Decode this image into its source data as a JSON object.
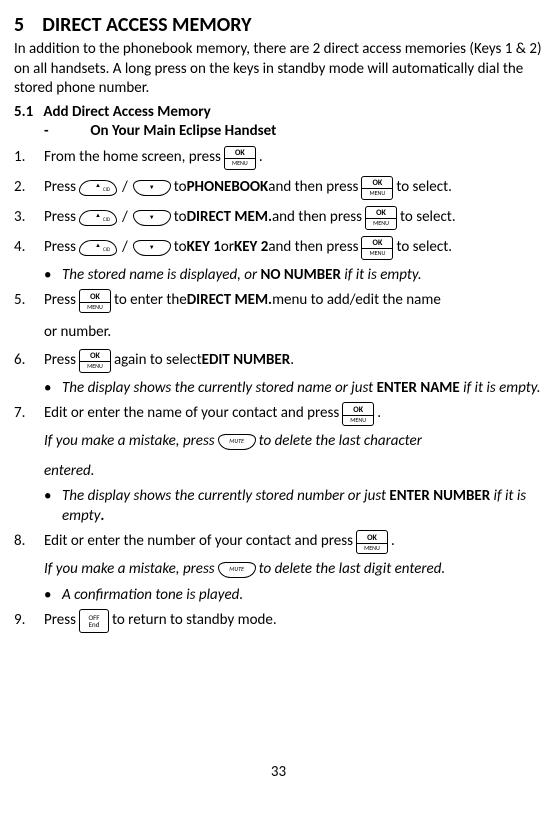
{
  "section": {
    "number": "5",
    "title": "DIRECT ACCESS MEMORY",
    "intro": "In addition to the phonebook memory, there are 2 direct access memories (Keys 1 & 2) on all handsets. A long press on the keys in standby mode will automatically dial the stored phone number."
  },
  "subsection": {
    "number": "5.1",
    "title": "Add Direct Access Memory",
    "handset_dash": "-",
    "handset_title": "On Your Main Eclipse Handset"
  },
  "steps": {
    "s1": {
      "num": "1.",
      "t1": "From the home screen, press ",
      "t2": " ."
    },
    "s2": {
      "num": "2.",
      "t1": "Press ",
      "slash": "/",
      "t2": " to ",
      "phonebook": "PHONEBOOK ",
      "t3": "and then press ",
      "t4": "  to select."
    },
    "s3": {
      "num": "3.",
      "t1": "Press ",
      "slash": "/",
      "t2": "  to ",
      "directmem": "DIRECT MEM.",
      "t3": " and then press ",
      "t4": "  to select."
    },
    "s4": {
      "num": "4.",
      "t1": "Press ",
      "slash": "/",
      "t2": " to ",
      "key1": "KEY 1",
      "or": " or ",
      "key2": "KEY 2",
      "t3": " and then press ",
      "t4": "  to select."
    },
    "s4_bullet": {
      "dot": "•",
      "t1": "The stored name is displayed, or ",
      "nonumber": "NO NUMBER",
      "t2": " if it is empty."
    },
    "s5": {
      "num": "5.",
      "t1": "Press ",
      "t2": "  to enter the ",
      "directmem": "DIRECT MEM.",
      "t3": " menu to add/edit the name",
      "t4": "or number."
    },
    "s6": {
      "num": "6.",
      "t1": "Press ",
      "t2": " again to select ",
      "editnum": "EDIT NUMBER",
      "t3": "."
    },
    "s6_bullet": {
      "dot": "•",
      "t1": "The display shows the currently stored name or just ",
      "entername": "ENTER NAME",
      "t2": " if it is empty."
    },
    "s7": {
      "num": "7.",
      "t1": "Edit or enter the name of your contact and press ",
      "t2": " .",
      "mistake1": "If you make a mistake, press ",
      "mistake2": " to delete the last character",
      "mistake3": "entered."
    },
    "s7_bullet": {
      "dot": "•",
      "t1": "The display shows the currently stored number or just ",
      "enternum": "ENTER NUMBER",
      "t2": " if it is empty",
      "period": "."
    },
    "s8": {
      "num": "8.",
      "t1": "Edit or enter the number of your contact and press ",
      "t2": " .",
      "mistake1": "If you make a mistake, press ",
      "mistake2": " to delete the last digit entered."
    },
    "s8_bullet": {
      "dot": "•",
      "t1": "A confirmation tone is played."
    },
    "s9": {
      "num": "9.",
      "t1": "Press ",
      "t2": " to return to standby mode."
    }
  },
  "buttons": {
    "ok_top": "OK",
    "ok_bot": "MENU",
    "mute": "MUTE",
    "off_top": "OFF",
    "off_bot": "End"
  },
  "page_number": "33"
}
